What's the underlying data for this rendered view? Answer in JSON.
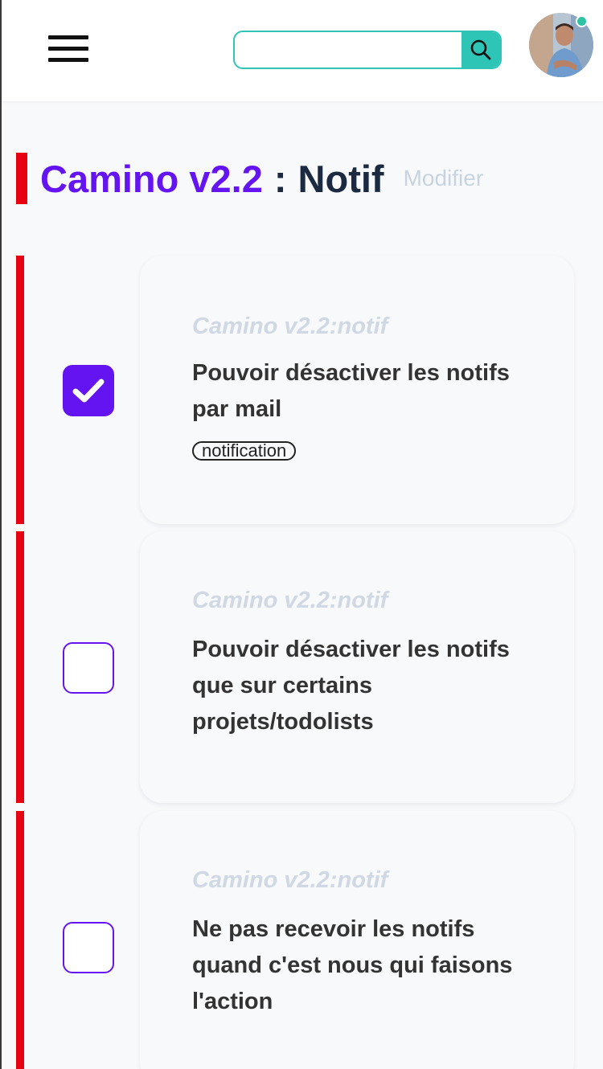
{
  "header": {
    "search": {
      "value": "",
      "placeholder": ""
    },
    "user": {
      "online": true
    }
  },
  "page": {
    "project": "Camino v2.2",
    "separator": ":",
    "section": "Notif",
    "modify_label": "Modifier"
  },
  "tasks": [
    {
      "project_label": "Camino v2.2:notif",
      "title": "Pouvoir désactiver les notifs par mail",
      "tags": [
        "notification"
      ],
      "checked": true
    },
    {
      "project_label": "Camino v2.2:notif",
      "title": "Pouvoir désactiver les notifs que sur certains projets/todolists",
      "tags": [],
      "checked": false
    },
    {
      "project_label": "Camino v2.2:notif",
      "title": "Ne pas recevoir les notifs quand c'est nous qui faisons l'action",
      "tags": [],
      "checked": false
    }
  ],
  "colors": {
    "accent": "#6414f0",
    "priority_bar": "#e60012",
    "search_accent": "#2ec4b6",
    "muted": "#cfd8e3",
    "status_online": "#2ec4a3"
  },
  "icons": {
    "menu": "hamburger-icon",
    "search": "search-icon",
    "check": "checkmark-icon"
  }
}
